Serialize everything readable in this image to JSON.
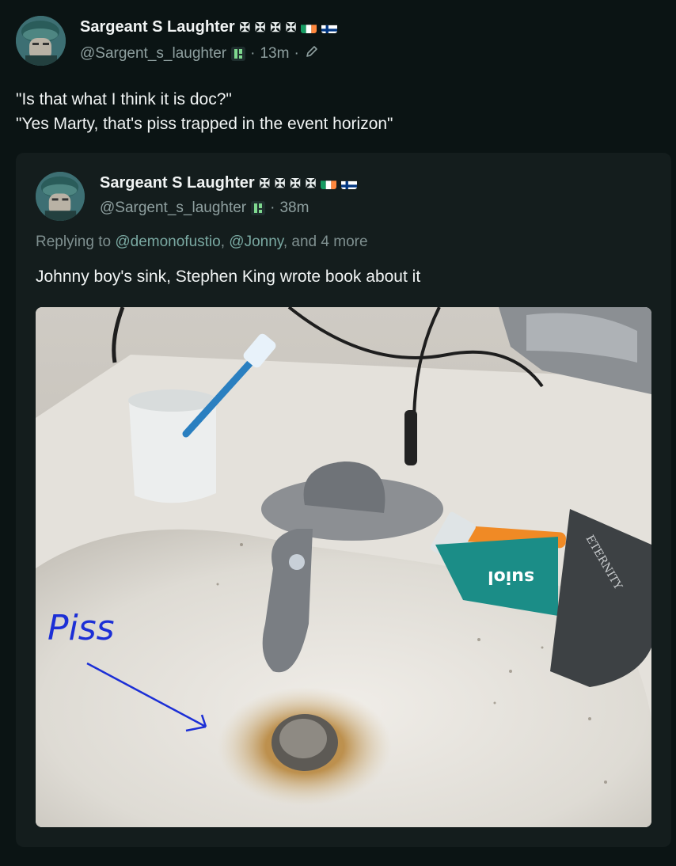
{
  "post": {
    "author_name": "Sargeant S Laughter",
    "handle": "@Sargent_s_laughter",
    "time": "13m",
    "text": "\"Is that what I think it is doc?\"\n\"Yes Marty, that's piss trapped in the event horizon\""
  },
  "quoted": {
    "author_name": "Sargeant S Laughter",
    "handle": "@Sargent_s_laughter",
    "time": "38m",
    "replying_prefix": "Replying to ",
    "mention_1": "@demonofustio",
    "mention_sep": ", ",
    "mention_2": "@Jonny",
    "replying_suffix": ", and 4 more",
    "text": "Johnny boy's sink, Stephen King wrote book about it",
    "image": {
      "annotation": "Piss",
      "product_label": "ETERNITY",
      "razor_label": "suiol"
    }
  },
  "icons": {
    "cross": "✠",
    "pleroma_badge": "pleroma-icon",
    "edit": "pencil-icon"
  }
}
